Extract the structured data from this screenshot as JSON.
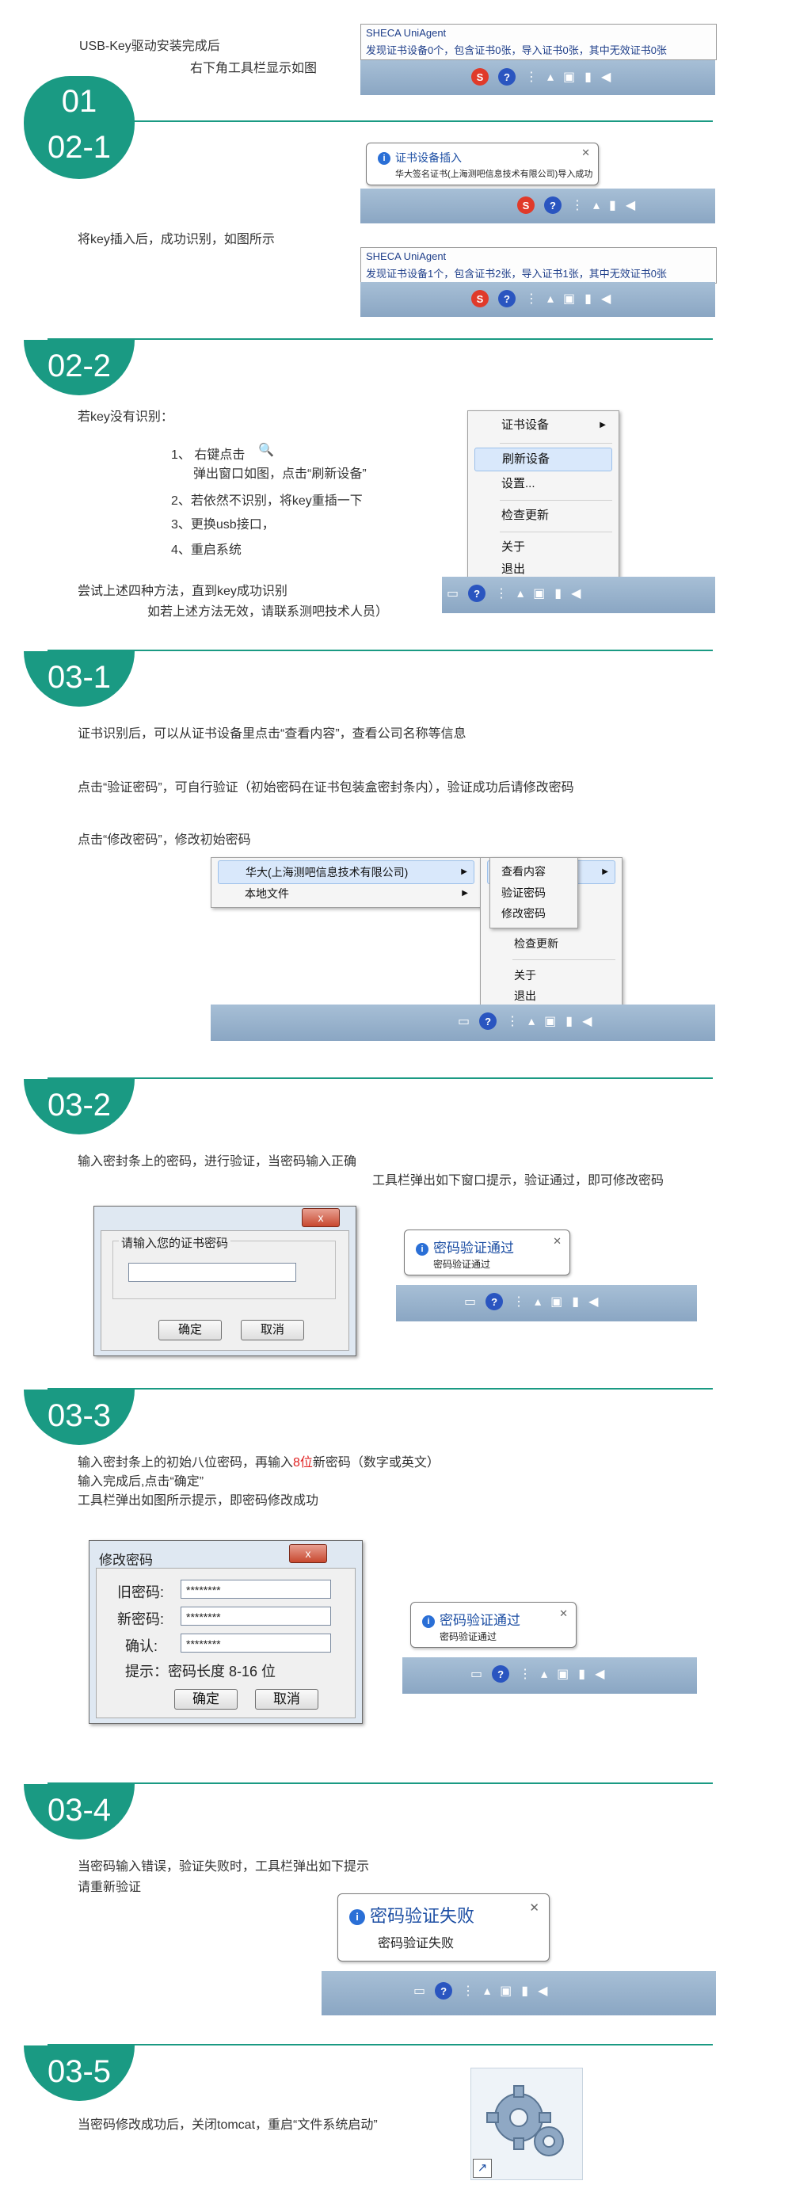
{
  "colors": {
    "accent": "#1a9a83",
    "highlight": "#e02020"
  },
  "s01": {
    "badge": "01",
    "line1": "USB-Key驱动安装完成后",
    "line2": "右下角工具栏显示如图",
    "popup_title": "SHECA UniAgent",
    "popup_text": "发现证书设备0个，包含证书0张，导入证书0张，其中无效证书0张"
  },
  "s021": {
    "badge": "02-1",
    "text": "将key插入后，成功识别，如图所示",
    "balloon_title": "证书设备插入",
    "balloon_sub": "华大签名证书(上海测吧信息技术有限公司)导入成功",
    "popup_title": "SHECA UniAgent",
    "popup_text": "发现证书设备1个，包含证书2张，导入证书1张，其中无效证书0张"
  },
  "s022": {
    "badge": "02-2",
    "intro": "若key没有识别：",
    "steps": [
      "1、  右键点击",
      "弹出窗口如图，点击“刷新设备”",
      "2、若依然不识别，将key重插一下",
      "3、更换usb接口，",
      "4、重启系统"
    ],
    "try": "尝试上述四种方法，直到key成功识别",
    "contact": "如若上述方法无效，请联系测吧技术人员）",
    "menu": [
      "证书设备",
      "刷新设备",
      "设置...",
      "检查更新",
      "关于",
      "退出"
    ]
  },
  "s031": {
    "badge": "03-1",
    "p1": "证书识别后，可以从证书设备里点击“查看内容”，查看公司名称等信息",
    "p2": "点击“验证密码”，可自行验证（初始密码在证书包装盒密封条内），验证成功后请修改密码",
    "p3": "点击“修改密码”，修改初始密码",
    "menu_left": [
      "华大(上海测吧信息技术有限公司)",
      "本地文件"
    ],
    "menu_right": [
      "查看内容",
      "验证密码",
      "修改密码"
    ],
    "menu_bottom": [
      "检查更新",
      "关于",
      "退出"
    ]
  },
  "s032": {
    "badge": "03-2",
    "p1": "输入密封条上的密码，进行验证，当密码输入正确",
    "p2": "工具栏弹出如下窗口提示，验证通过，即可修改密码",
    "dlg_close": "x",
    "dlg_label": "请输入您的证书密码",
    "ok": "确定",
    "cancel": "取消",
    "balloon_title": "密码验证通过",
    "balloon_sub": "密码验证通过"
  },
  "s033": {
    "badge": "03-3",
    "p1a": "输入密封条上的初始八位密码，再输入",
    "p1b": "8位",
    "p1c": "新密码（数字或英文）",
    "p2": "输入完成后,点击“确定”",
    "p3": "工具栏弹出如图所示提示，即密码修改成功",
    "dlg_title": "修改密码",
    "dlg_close": "x",
    "old": "旧密码:",
    "new": "新密码:",
    "confirm": "确认:",
    "mask": "********",
    "hint": "提示：密码长度 8-16 位",
    "ok": "确定",
    "cancel": "取消",
    "balloon_title": "密码验证通过",
    "balloon_sub": "密码验证通过"
  },
  "s034": {
    "badge": "03-4",
    "p1": "当密码输入错误，验证失败时，工具栏弹出如下提示",
    "p2": "请重新验证",
    "balloon_title": "密码验证失败",
    "balloon_sub": "密码验证失败"
  },
  "s035": {
    "badge": "03-5",
    "p1": "当密码修改成功后，关闭tomcat，重启“文件系统启动”"
  }
}
